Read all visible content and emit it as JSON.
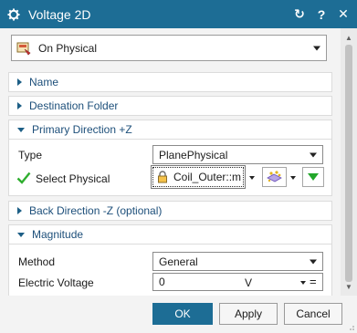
{
  "window": {
    "title": "Voltage 2D",
    "buttons": {
      "reset": "↻",
      "help": "?",
      "close": "✕"
    }
  },
  "top_select": {
    "value": "On Physical"
  },
  "sections": {
    "name": {
      "label": "Name",
      "expanded": false
    },
    "destination": {
      "label": "Destination Folder",
      "expanded": false
    },
    "primary": {
      "label": "Primary Direction +Z",
      "expanded": true
    },
    "back": {
      "label": "Back Direction -Z (optional)",
      "expanded": false
    },
    "magnitude": {
      "label": "Magnitude",
      "expanded": true
    }
  },
  "primary_direction": {
    "type_label": "Type",
    "type_value": "PlanePhysical",
    "select_label": "Select Physical",
    "select_value": "Coil_Outer::m"
  },
  "magnitude": {
    "method_label": "Method",
    "method_value": "General",
    "voltage_label": "Electric Voltage",
    "voltage_value": "0",
    "voltage_unit": "V",
    "voltage_operator": "="
  },
  "footer": {
    "ok": "OK",
    "apply": "Apply",
    "cancel": "Cancel"
  },
  "colors": {
    "accent": "#1d6d95",
    "section_text": "#1d4f7a",
    "check": "#2fae2f"
  },
  "icons": {
    "app": "gear-icon",
    "reset": "reset-icon",
    "help": "help-icon",
    "close": "close-icon",
    "top_select": "physical-object-icon",
    "lock": "lock-icon",
    "check": "check-icon",
    "filter": "selection-filter-icon",
    "green_arrow": "green-down-arrow-icon"
  }
}
